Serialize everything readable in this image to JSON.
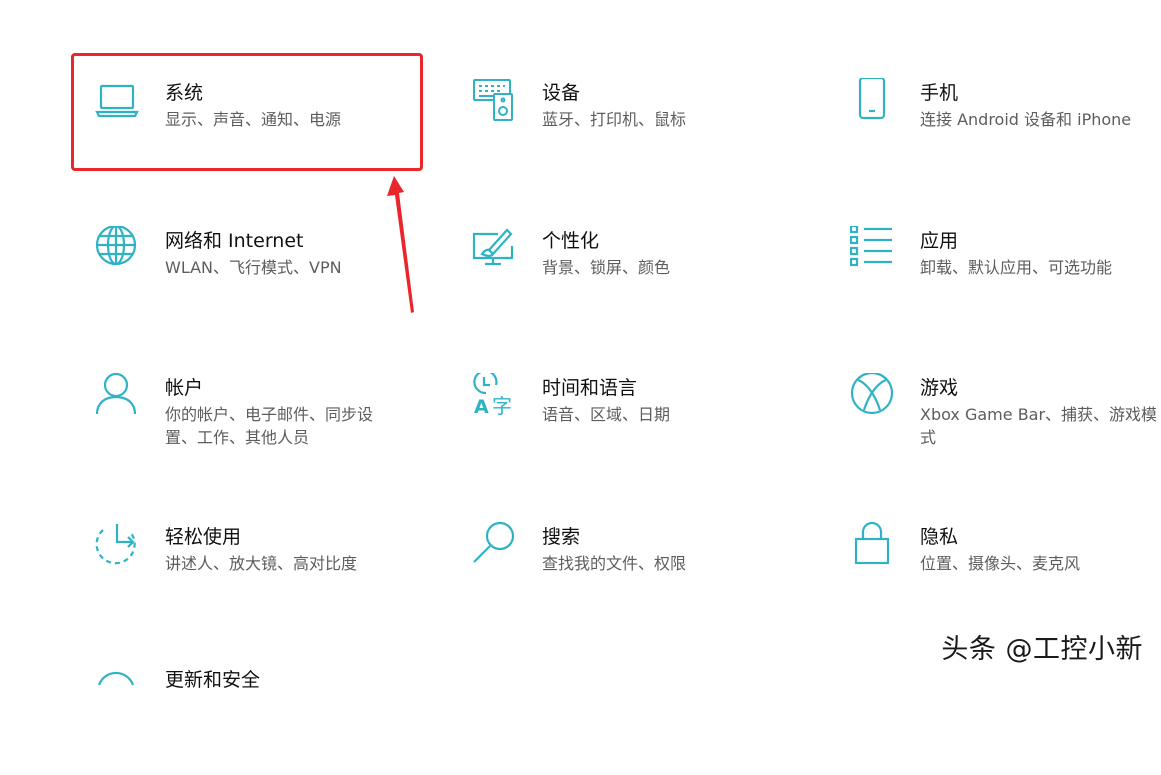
{
  "colors": {
    "accent": "#2fb3c4",
    "highlight": "#e8262b"
  },
  "tiles": {
    "system": {
      "title": "系统",
      "desc": "显示、声音、通知、电源",
      "icon": "laptop-icon"
    },
    "devices": {
      "title": "设备",
      "desc": "蓝牙、打印机、鼠标",
      "icon": "devices-icon"
    },
    "phone": {
      "title": "手机",
      "desc": "连接 Android 设备和 iPhone",
      "icon": "phone-icon"
    },
    "network": {
      "title": "网络和 Internet",
      "desc": "WLAN、飞行模式、VPN",
      "icon": "globe-icon"
    },
    "personal": {
      "title": "个性化",
      "desc": "背景、锁屏、颜色",
      "icon": "paint-monitor-icon"
    },
    "apps": {
      "title": "应用",
      "desc": "卸载、默认应用、可选功能",
      "icon": "app-list-icon"
    },
    "accounts": {
      "title": "帐户",
      "desc": "你的帐户、电子邮件、同步设置、工作、其他人员",
      "icon": "person-icon"
    },
    "time": {
      "title": "时间和语言",
      "desc": "语音、区域、日期",
      "icon": "time-language-icon"
    },
    "gaming": {
      "title": "游戏",
      "desc": "Xbox Game Bar、捕获、游戏模式",
      "icon": "xbox-icon"
    },
    "ease": {
      "title": "轻松使用",
      "desc": "讲述人、放大镜、高对比度",
      "icon": "ease-of-access-icon"
    },
    "search": {
      "title": "搜索",
      "desc": "查找我的文件、权限",
      "icon": "search-icon"
    },
    "privacy": {
      "title": "隐私",
      "desc": "位置、摄像头、麦克风",
      "icon": "lock-icon"
    },
    "update": {
      "title": "更新和安全",
      "icon": "update-icon"
    }
  },
  "watermark": "头条 @工控小新"
}
